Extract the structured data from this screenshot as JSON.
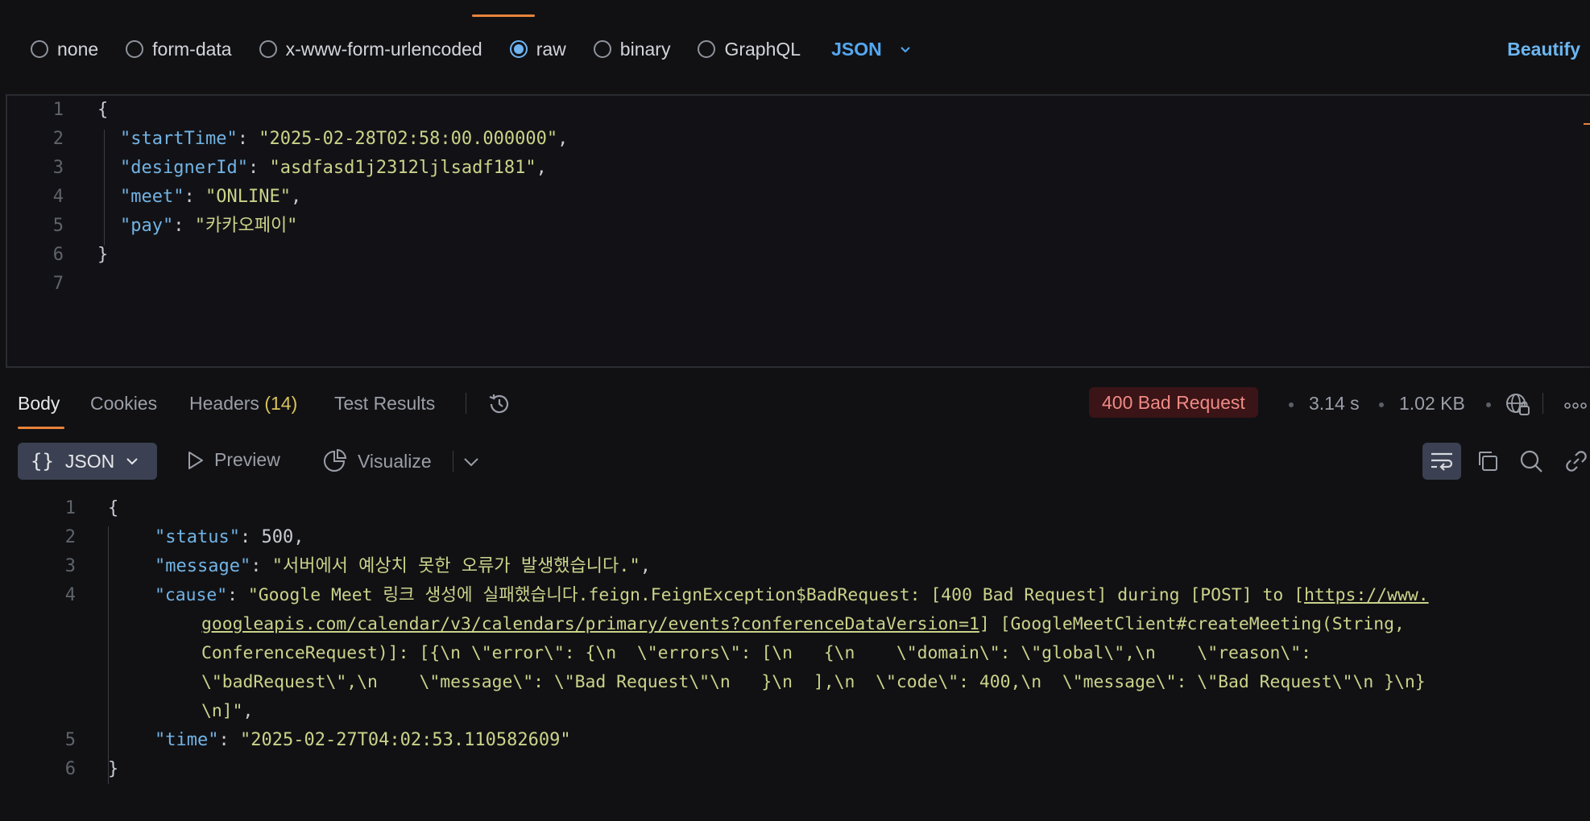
{
  "body_types": {
    "options": [
      {
        "label": "none",
        "selected": false
      },
      {
        "label": "form-data",
        "selected": false
      },
      {
        "label": "x-www-form-urlencoded",
        "selected": false
      },
      {
        "label": "raw",
        "selected": true
      },
      {
        "label": "binary",
        "selected": false
      },
      {
        "label": "GraphQL",
        "selected": false
      }
    ],
    "language": "JSON",
    "beautify_label": "Beautify"
  },
  "request_body": {
    "line_numbers": [
      "1",
      "2",
      "3",
      "4",
      "5",
      "6",
      "7"
    ],
    "open_brace": "{",
    "close_brace": "}",
    "fields": [
      {
        "key": "\"startTime\"",
        "value": "\"2025-02-28T02:58:00.000000\"",
        "trail": ","
      },
      {
        "key": "\"designerId\"",
        "value": "\"asdfasd1j2312ljlsadf181\"",
        "trail": ","
      },
      {
        "key": "\"meet\"",
        "value": "\"ONLINE\"",
        "trail": ","
      },
      {
        "key": "\"pay\"",
        "value": "\"카카오페이\"",
        "trail": ""
      }
    ]
  },
  "response_tabs": {
    "body": "Body",
    "cookies": "Cookies",
    "headers": "Headers",
    "headers_count": "(14)",
    "test_results": "Test Results"
  },
  "response_meta": {
    "status": "400 Bad Request",
    "time": "3.14 s",
    "size": "1.02 KB",
    "status_color": "#ef8a86"
  },
  "response_toolbar": {
    "format": "JSON",
    "preview": "Preview",
    "visualize": "Visualize"
  },
  "response_body": {
    "line_numbers": [
      "1",
      "2",
      "3",
      "4",
      "5",
      "6"
    ],
    "open_brace": "{",
    "close_brace": "}",
    "status_key": "\"status\"",
    "status_value": "500",
    "message_key": "\"message\"",
    "message_value": "\"서버에서 예상치 못한 오류가 발생했습니다.\"",
    "cause_key": "\"cause\"",
    "cause_line1_pre": "\"Google Meet 링크 생성에 실패했습니다.feign.FeignException$BadRequest: [400 Bad Request] during [POST] to [",
    "cause_url_part1": "https://www.",
    "cause_url_part2": "googleapis.com/calendar/v3/calendars/primary/events?conferenceDataVersion=1",
    "cause_line2_post": "] [GoogleMeetClient#createMeeting(String,",
    "cause_line3": "ConferenceRequest)]: [{\\n \\\"error\\\": {\\n  \\\"errors\\\": [\\n   {\\n    \\\"domain\\\": \\\"global\\\",\\n    \\\"reason\\\":",
    "cause_line4": "\\\"badRequest\\\",\\n    \\\"message\\\": \\\"Bad Request\\\"\\n   }\\n  ],\\n  \\\"code\\\": 400,\\n  \\\"message\\\": \\\"Bad Request\\\"\\n }\\n}",
    "cause_line5": "\\n]\"",
    "time_key": "\"time\"",
    "time_value": "\"2025-02-27T04:02:53.110582609\""
  }
}
